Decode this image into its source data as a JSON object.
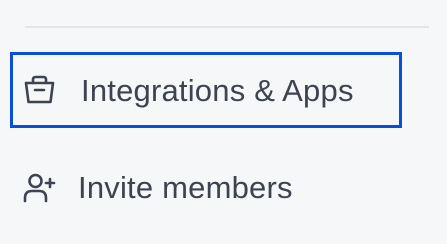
{
  "menu": {
    "items": [
      {
        "label": "Integrations & Apps",
        "icon": "shopping-bag-icon",
        "selected": true
      },
      {
        "label": "Invite members",
        "icon": "user-add-icon",
        "selected": false
      }
    ]
  },
  "colors": {
    "background": "#f6f7f9",
    "text": "#3e4350",
    "divider": "#e2e4e8",
    "focus_outline": "#0a4fd8"
  }
}
